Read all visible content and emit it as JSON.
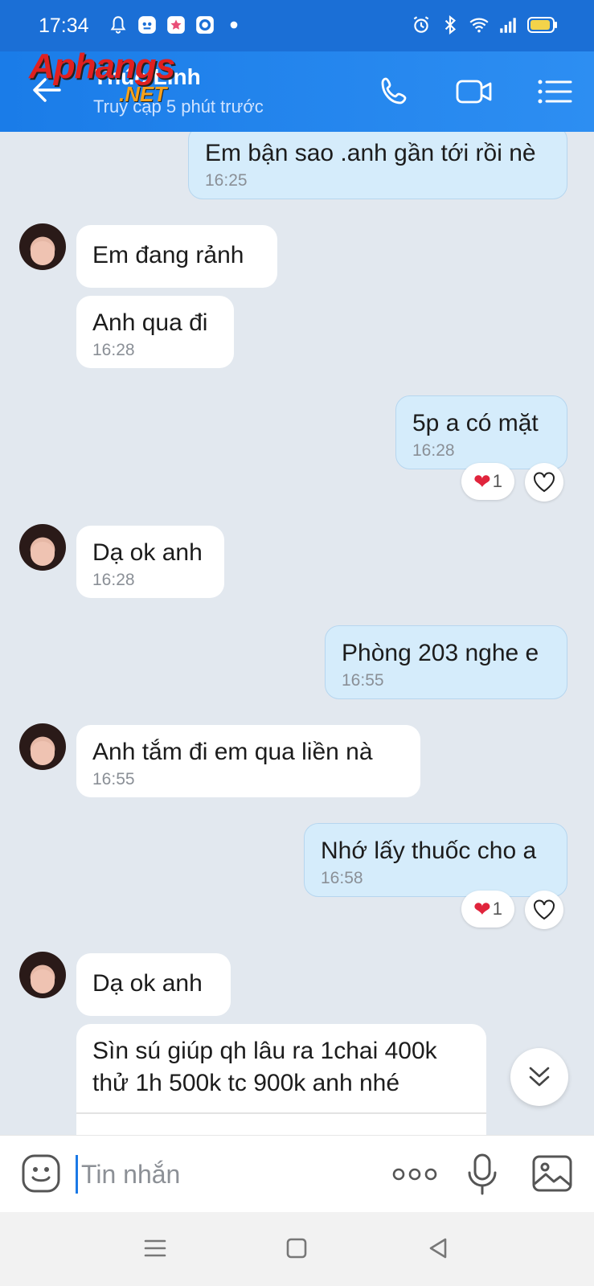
{
  "status_bar": {
    "time": "17:34"
  },
  "header": {
    "contact_name": "Thúc Linh",
    "last_seen": "Truy cập 5 phút trước",
    "watermark_main": "Aphangs",
    "watermark_sub": ".NET"
  },
  "messages": [
    {
      "dir": "out",
      "text": "Em bận sao .anh gần tới rồi nè",
      "time": "16:25"
    },
    {
      "dir": "in",
      "text": "Em đang rảnh",
      "time": ""
    },
    {
      "dir": "in",
      "text": "Anh qua đi",
      "time": "16:28"
    },
    {
      "dir": "out",
      "text": "5p a có mặt",
      "time": "16:28",
      "reaction_count": "1"
    },
    {
      "dir": "in",
      "text": "Dạ ok anh",
      "time": "16:28"
    },
    {
      "dir": "out",
      "text": "Phòng 203 nghe e",
      "time": "16:55"
    },
    {
      "dir": "in",
      "text": "Anh tắm đi em qua liền nà",
      "time": "16:55"
    },
    {
      "dir": "out",
      "text": "Nhớ lấy thuốc cho a",
      "time": "16:58",
      "reaction_count": "1"
    },
    {
      "dir": "in",
      "text": "Dạ ok anh",
      "time": ""
    },
    {
      "dir": "in",
      "text_line1": "Sìn sú giúp qh lâu ra 1chai 400k",
      "text_line2": "thử 1h 500k tc 900k anh nhé"
    }
  ],
  "composer": {
    "placeholder": "Tin nhắn"
  },
  "colors": {
    "header_blue": "#1a7ce8",
    "outgoing_bubble": "#d5ecfb",
    "chat_background": "#e2e8ef",
    "heart": "#e0243c"
  },
  "icons": [
    "bell-icon",
    "alarm-icon",
    "bluetooth-icon",
    "wifi-icon",
    "signal-icon",
    "battery-icon",
    "back-arrow-icon",
    "phone-icon",
    "video-icon",
    "menu-icon",
    "emoji-icon",
    "more-icon",
    "mic-icon",
    "image-icon",
    "heart-icon",
    "chevron-double-down-icon"
  ]
}
